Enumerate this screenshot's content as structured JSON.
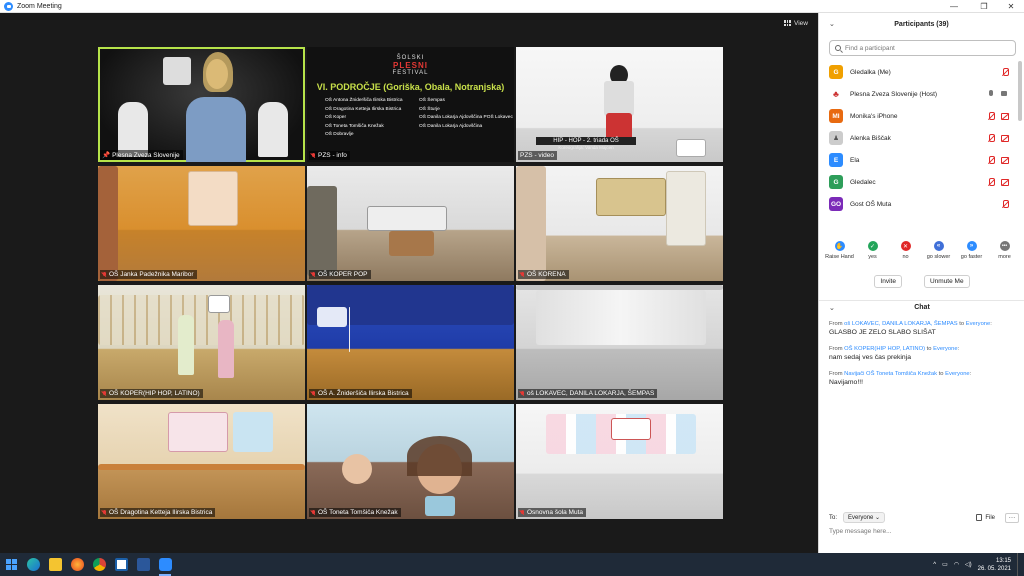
{
  "window": {
    "title": "Zoom Meeting"
  },
  "view_label": "View",
  "tiles": [
    {
      "label": "Plesna Zveza Slovenije",
      "muted": false,
      "pinned": true
    },
    {
      "label": "PZS - info",
      "muted": true
    },
    {
      "label": "PZS - video",
      "muted": false
    },
    {
      "label": "OŠ Janka Padežnika Maribor",
      "muted": true
    },
    {
      "label": "OŠ KOPER POP",
      "muted": true
    },
    {
      "label": "OŠ KORENA",
      "muted": true
    },
    {
      "label": "OŠ KOPER(HIP HOP, LATINO)",
      "muted": true
    },
    {
      "label": "OŠ A. Žnideršiča Ilirska Bistrica",
      "muted": true
    },
    {
      "label": "oš LOKAVEC, DANILA LOKARJA, ŠEMPAS",
      "muted": true
    },
    {
      "label": "OŠ Dragotina Ketteja Ilirska Bistrica",
      "muted": true
    },
    {
      "label": "OŠ Toneta Tomšiča Knežak",
      "muted": true
    },
    {
      "label": "Osnovna šola Muta",
      "muted": true
    }
  ],
  "info_slide": {
    "logo_small": "ŠOLSKI",
    "logo_big": "PLESNI",
    "logo_bottom": "FESTIVAL",
    "heading": "VI. PODROČJE (Goriška, Obala, Notranjska)",
    "left_col": [
      "OŠ Antona Žnideršiča Ilirska Bistrica",
      "OŠ Dragotina Ketteja Ilirska Bistrica",
      "OŠ Koper",
      "OŠ Toneta Tomšiča Knežak",
      "OŠ Dobravlje"
    ],
    "right_col": [
      "OŠ Šempas",
      "OŠ Šturje",
      "OŠ Danila Lokarja Ajdovščina POŠ Lokavec",
      "OŠ Danila Lokarja Ajdovščina"
    ]
  },
  "video_slide": {
    "banner": "HIP - HOP - 2. triada OŠ",
    "sub": "Koreografija: Vanda Majcen"
  },
  "participants": {
    "title": "Participants (39)",
    "search_placeholder": "Find a participant",
    "list": [
      {
        "initials": "G",
        "name": "Gledalka (Me)",
        "color": "#f0a000",
        "mic": "muted",
        "video": "none"
      },
      {
        "initials": "",
        "name": "Plesna Zveza Slovenije (Host)",
        "color": "#ffffff",
        "mic": "on",
        "video": "on"
      },
      {
        "initials": "MI",
        "name": "Monika's iPhone",
        "color": "#e86a10",
        "mic": "muted",
        "video": "off"
      },
      {
        "initials": "",
        "name": "Alenka Biščak",
        "color": "#cccccc",
        "mic": "muted",
        "video": "off"
      },
      {
        "initials": "E",
        "name": "Ela",
        "color": "#2d8cff",
        "mic": "muted",
        "video": "off"
      },
      {
        "initials": "G",
        "name": "Gledalec",
        "color": "#2e9e5a",
        "mic": "muted",
        "video": "off"
      },
      {
        "initials": "GO",
        "name": "Gost OŠ Muta",
        "color": "#7b2bb8",
        "mic": "muted",
        "video": "none"
      }
    ]
  },
  "reactions": [
    {
      "label": "Raise Hand",
      "color": "#2d8cff",
      "glyph": "✋"
    },
    {
      "label": "yes",
      "color": "#23a55a",
      "glyph": "✓"
    },
    {
      "label": "no",
      "color": "#e02828",
      "glyph": "✕"
    },
    {
      "label": "go slower",
      "color": "#3f6fd8",
      "glyph": "«"
    },
    {
      "label": "go faster",
      "color": "#2d8cff",
      "glyph": "»"
    },
    {
      "label": "more",
      "color": "#777777",
      "glyph": "•••"
    }
  ],
  "panel_buttons": {
    "invite": "Invite",
    "unmute": "Unmute Me"
  },
  "chat": {
    "title": "Chat",
    "messages": [
      {
        "from_label": "From",
        "from": "oš LOKAVEC, DANILA LOKARJA, ŠEMPAS",
        "to_label": "to",
        "to": "Everyone",
        "text": "GLASBO JE ZELO SLABO SLIŠAT"
      },
      {
        "from_label": "From",
        "from": "OŠ KOPER(HIP HOP, LATINO)",
        "to_label": "to",
        "to": "Everyone",
        "text": "nam sedaj ves čas prekinja"
      },
      {
        "from_label": "From",
        "from": "Navijači OŠ Toneta Tomšiča Knežak",
        "to_label": "to",
        "to": "Everyone",
        "text": "Navijamo!!!"
      }
    ],
    "to_label": "To:",
    "to_value": "Everyone",
    "file_label": "File",
    "input_placeholder": "Type message here..."
  },
  "taskbar": {
    "time": "13:15",
    "date": "26. 05. 2021"
  }
}
